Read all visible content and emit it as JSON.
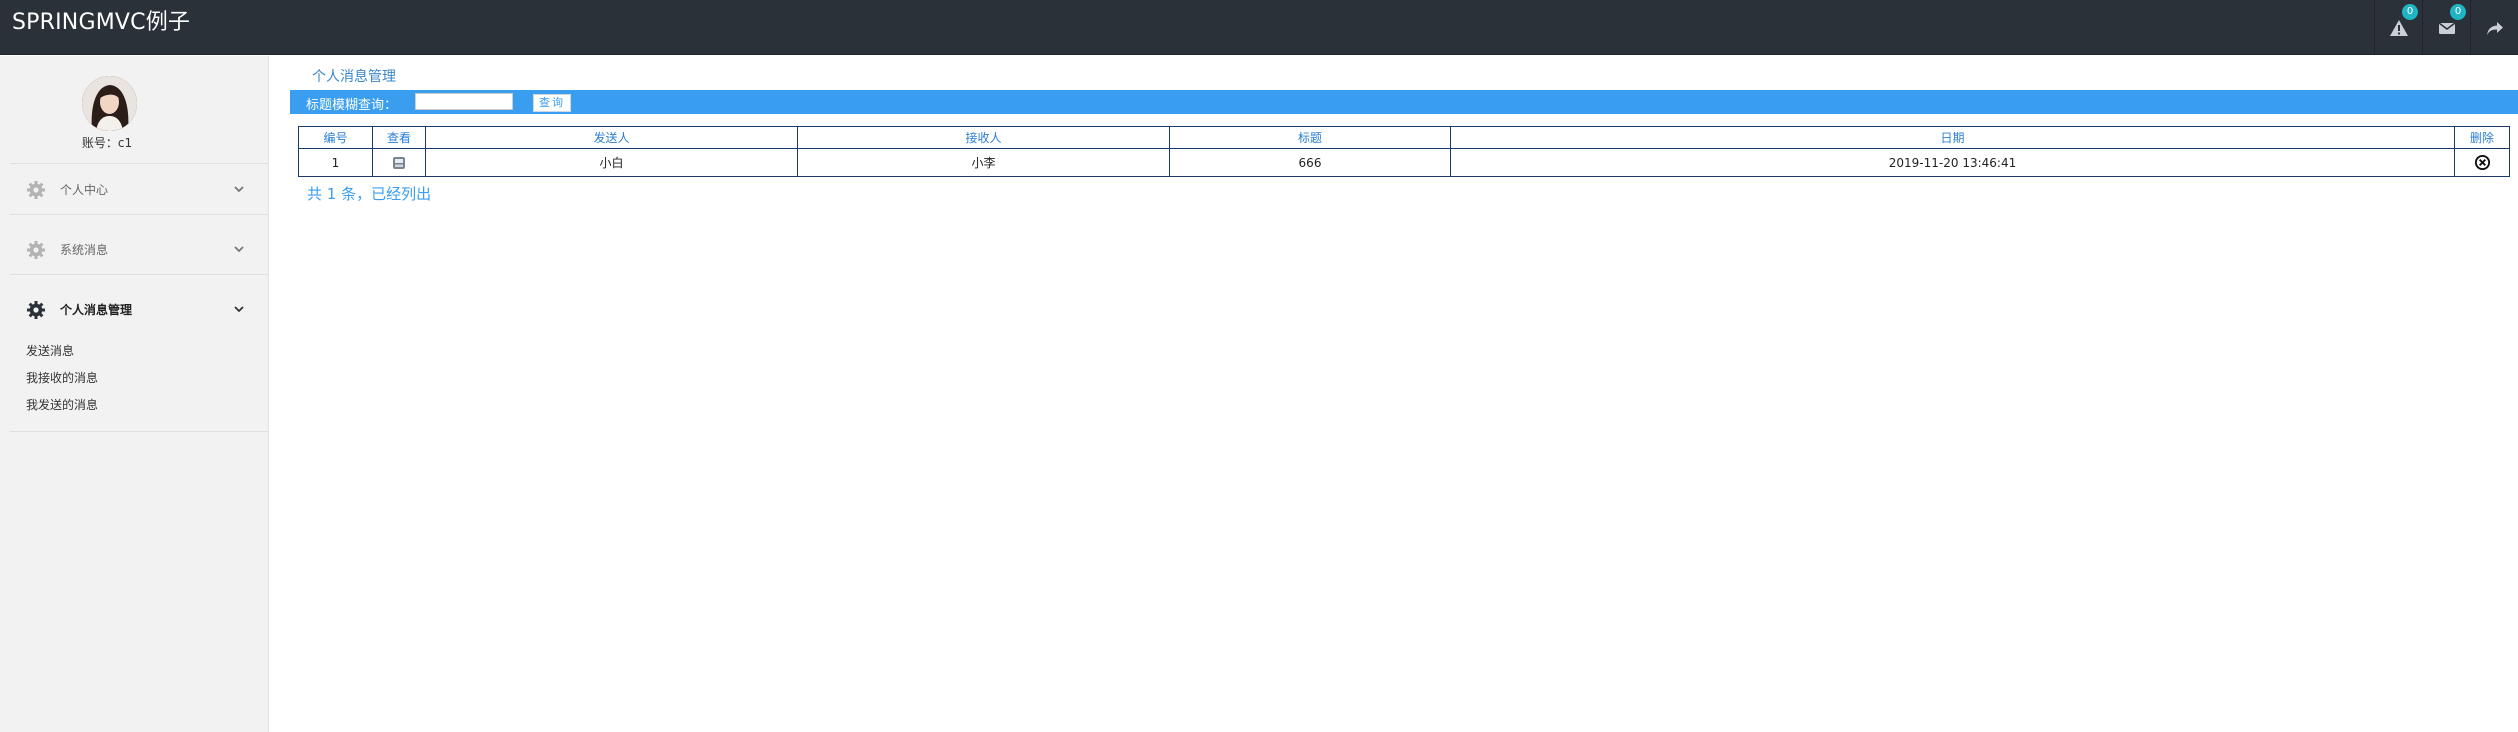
{
  "app": {
    "title": "SPRINGMVC例子"
  },
  "header": {
    "alerts": {
      "icon": "warning-icon",
      "count": "0"
    },
    "messages": {
      "icon": "envelope-icon",
      "count": "0"
    },
    "logout": {
      "icon": "share-arrow-icon"
    }
  },
  "sidebar": {
    "account": "账号：c1",
    "menus": [
      {
        "label": "个人中心",
        "icon": "gear-icon",
        "active": false
      },
      {
        "label": "系统消息",
        "icon": "gear-icon",
        "active": false
      },
      {
        "label": "个人消息管理",
        "icon": "gear-icon",
        "active": true
      }
    ],
    "submenu": [
      "发送消息",
      "我接收的消息",
      "我发送的消息"
    ]
  },
  "page": {
    "title": "个人消息管理",
    "search": {
      "label": "标题模糊查询：",
      "value": "",
      "button": "查询"
    },
    "table": {
      "headers": [
        "编号",
        "查看",
        "发送人",
        "接收人",
        "标题",
        "日期",
        "删除"
      ],
      "rows": [
        {
          "id": "1",
          "sender": "小白",
          "receiver": "小李",
          "title": "666",
          "date": "2019-11-20 13:46:41"
        }
      ]
    },
    "summary": "共 1 条，已经列出"
  },
  "colors": {
    "topbar": "#2a3139",
    "accent": "#3a9ef0",
    "badge": "#1fb5c4",
    "sidebar": "#f2f2f2"
  }
}
